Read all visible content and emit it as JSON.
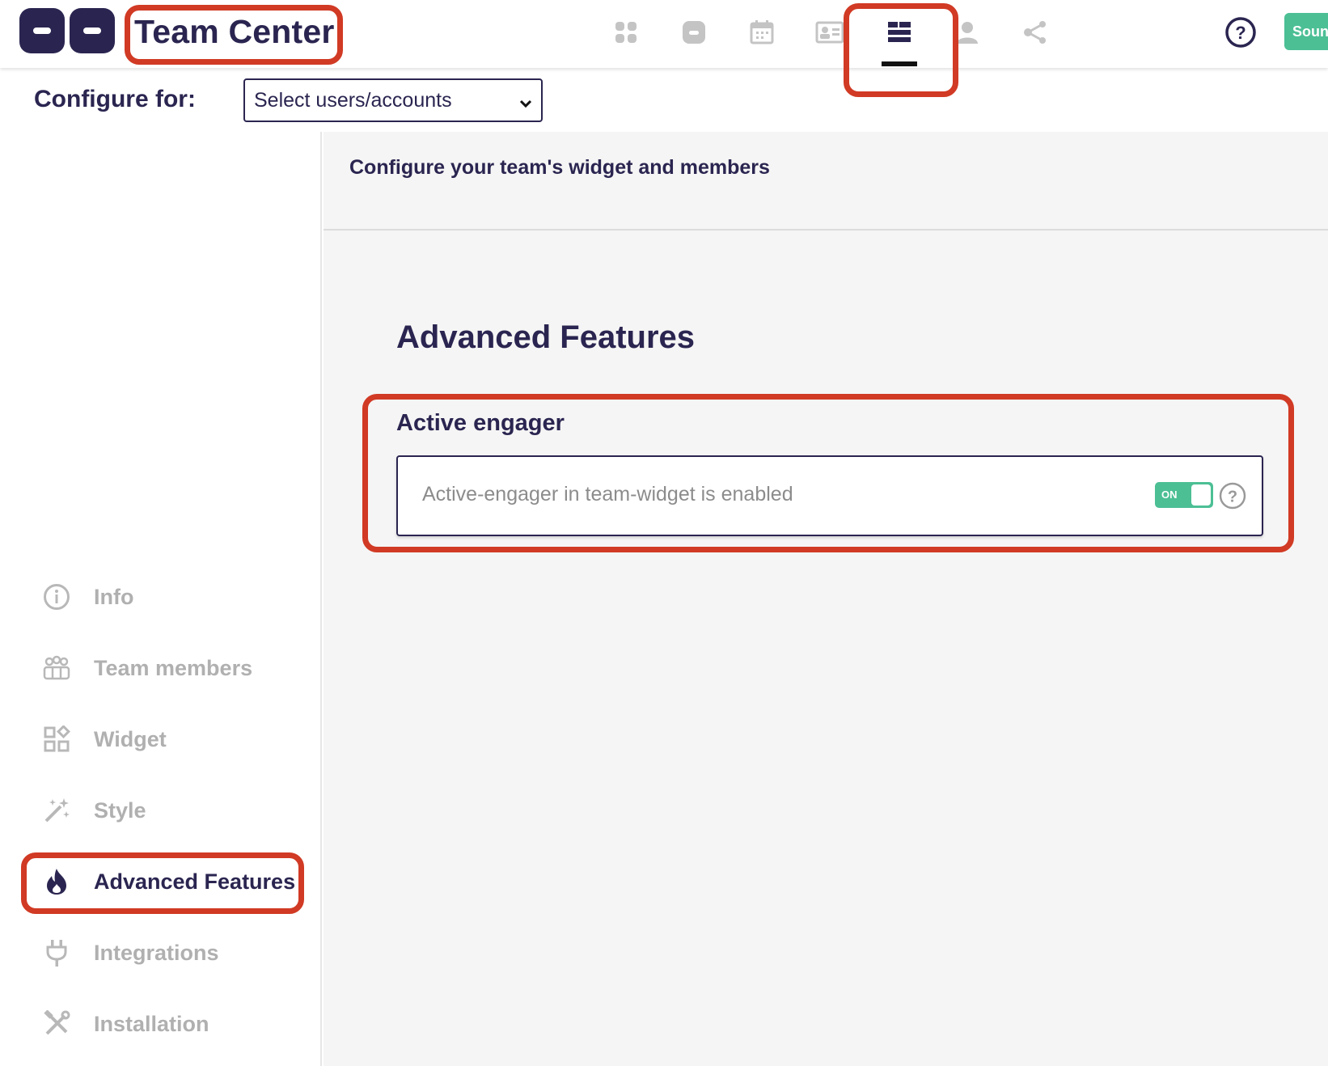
{
  "app": {
    "title": "Team Center"
  },
  "top_nav": {
    "icons": [
      "grid-icon",
      "chat-icon",
      "calendar-icon",
      "contact-card-icon",
      "layout-list-icon",
      "person-icon",
      "share-icon"
    ],
    "active_index": 4,
    "help_icon": "help-circle-icon",
    "sound_button_label": "Sounds"
  },
  "config": {
    "label": "Configure for:",
    "select_value": "Select users/accounts"
  },
  "sidebar": {
    "items": [
      {
        "label": "Info",
        "icon": "info-icon"
      },
      {
        "label": "Team members",
        "icon": "team-icon"
      },
      {
        "label": "Widget",
        "icon": "widget-icon"
      },
      {
        "label": "Style",
        "icon": "magic-wand-icon"
      },
      {
        "label": "Advanced Features",
        "icon": "flame-icon"
      },
      {
        "label": "Integrations",
        "icon": "plug-icon"
      },
      {
        "label": "Installation",
        "icon": "tools-icon"
      }
    ],
    "active_index": 4
  },
  "main": {
    "subtitle": "Configure your team's widget and members",
    "section_title": "Advanced Features",
    "feature": {
      "title": "Active engager",
      "description": "Active-engager in team-widget is enabled",
      "toggle_label": "ON",
      "toggle_on": true
    }
  },
  "colors": {
    "primary": "#2a2550",
    "accent": "#4cbf95",
    "annotation": "#d13a24",
    "muted": "#b0b0b0"
  }
}
